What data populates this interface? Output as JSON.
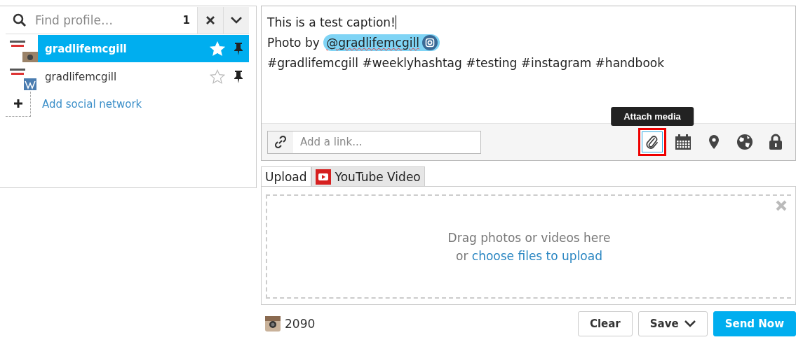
{
  "search": {
    "placeholder": "Find profile…",
    "count": "1"
  },
  "profiles": [
    {
      "name": "gradlifemcgill",
      "kind": "instagram",
      "selected": true,
      "favorite": true
    },
    {
      "name": "gradlifemcgill",
      "kind": "wordpress",
      "selected": false,
      "favorite": false
    }
  ],
  "add_network": "Add social network",
  "caption": {
    "text": "This is a test caption!",
    "credit_prefix": "Photo by",
    "mention": "@gradlifemcgill",
    "hashtags": "#gradlifemcgill #weeklyhashtag #testing #instagram #handbook"
  },
  "link_field": {
    "placeholder": "Add a link..."
  },
  "tools": [
    {
      "kind": "attach",
      "selected": true,
      "tooltip": "Attach media"
    },
    {
      "kind": "calendar",
      "selected": false
    },
    {
      "kind": "location",
      "selected": false
    },
    {
      "kind": "globe",
      "selected": false
    },
    {
      "kind": "lock",
      "selected": false
    }
  ],
  "media_tabs": [
    {
      "label": "Upload",
      "kind": "upload",
      "selected": true
    },
    {
      "label": "YouTube Video",
      "kind": "youtube",
      "selected": false
    }
  ],
  "dropzone": {
    "text": "Drag photos or videos here",
    "prefix": "or",
    "link": "choose files to upload"
  },
  "counter": "2090",
  "buttons": [
    {
      "label": "Clear",
      "kind": "plain"
    },
    {
      "label": "Save",
      "kind": "menu"
    },
    {
      "label": "Send Now",
      "kind": "primary"
    }
  ]
}
